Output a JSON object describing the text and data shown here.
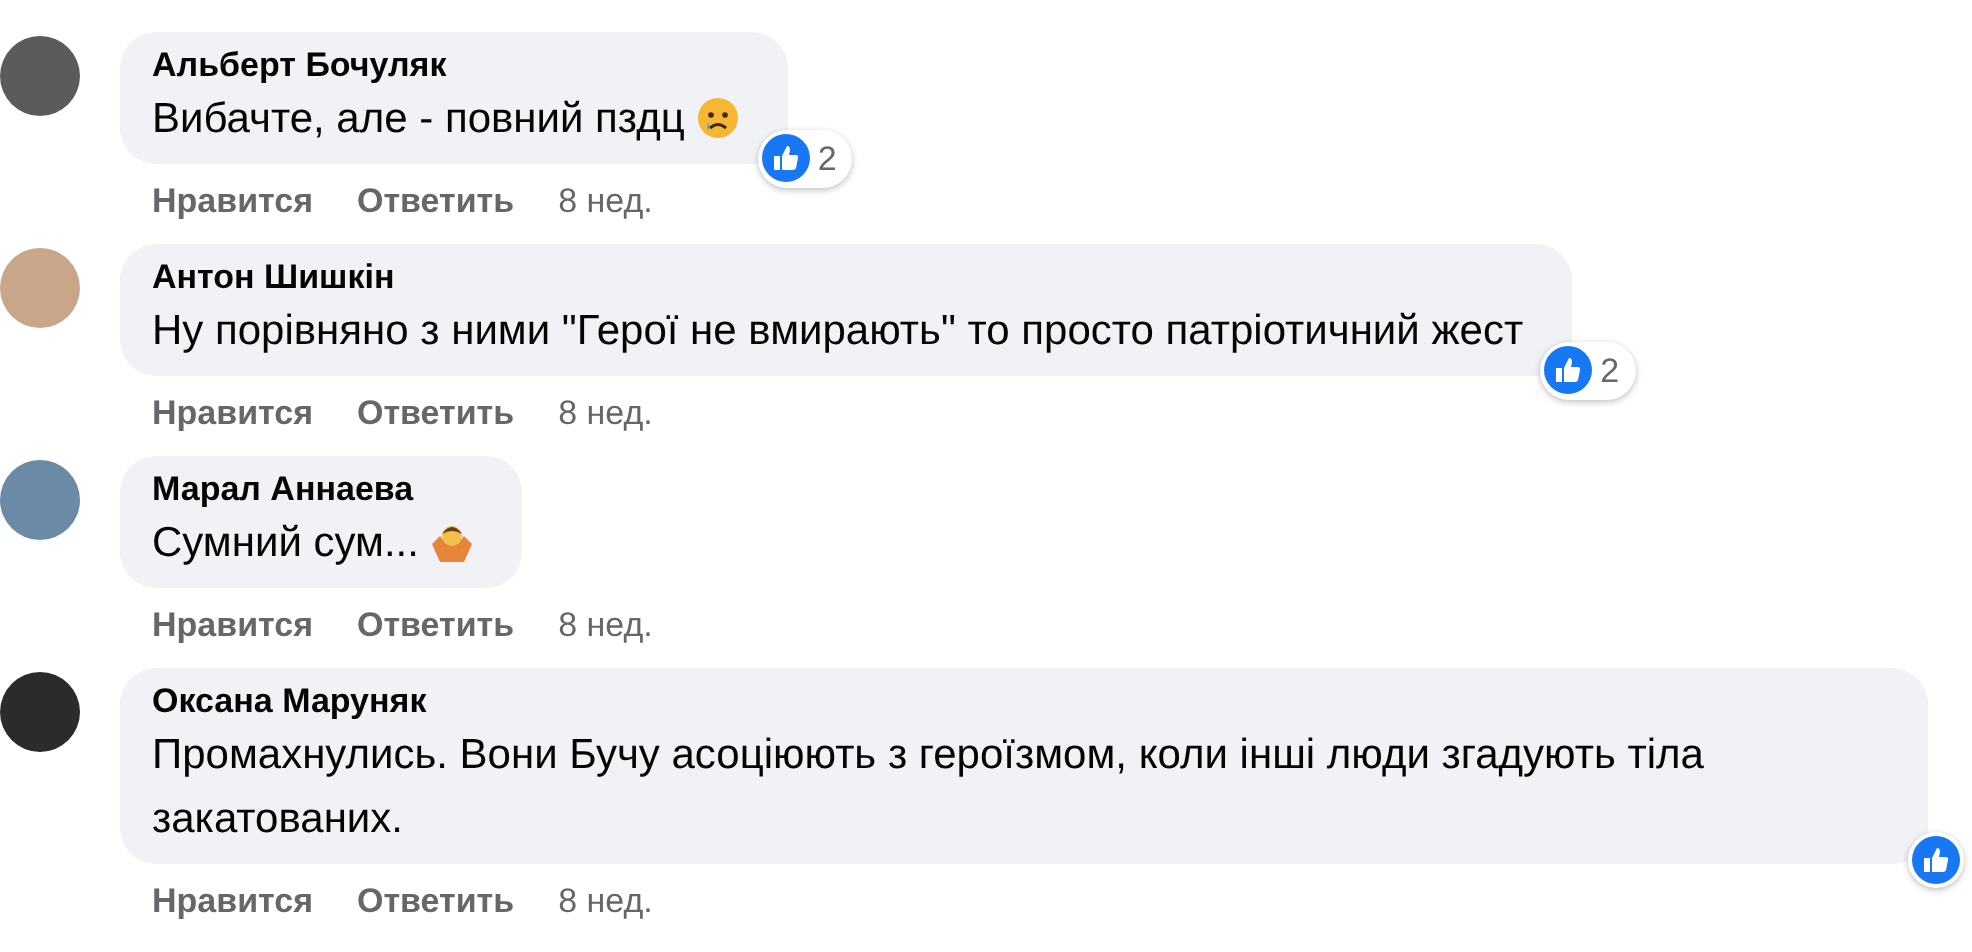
{
  "comments": [
    {
      "author": "Альберт Бочуляк",
      "text": "Вибачте, але - повний пздц",
      "kind": "sad",
      "reaction_count": "2",
      "like": "Нравится",
      "reply": "Ответить",
      "time": "8 нед."
    },
    {
      "author": "Антон Шишкін",
      "text": "Ну порівняно з ними \"Герої не вмирають\" то просто патріотичний жест",
      "kind": "plain",
      "reaction_count": "2",
      "like": "Нравится",
      "reply": "Ответить",
      "time": "8 нед."
    },
    {
      "author": "Марал Аннаева",
      "text": "Сумний сум...",
      "kind": "shrug",
      "like": "Нравится",
      "reply": "Ответить",
      "time": "8 нед."
    },
    {
      "author": "Оксана Маруняк",
      "text": "Промахнулись. Вони Бучу асоціюють з героїзмом, коли інші люди згадують тіла закатованих.",
      "kind": "plain",
      "liked": true,
      "like": "Нравится",
      "reply": "Ответить",
      "time": "8 нед."
    }
  ]
}
